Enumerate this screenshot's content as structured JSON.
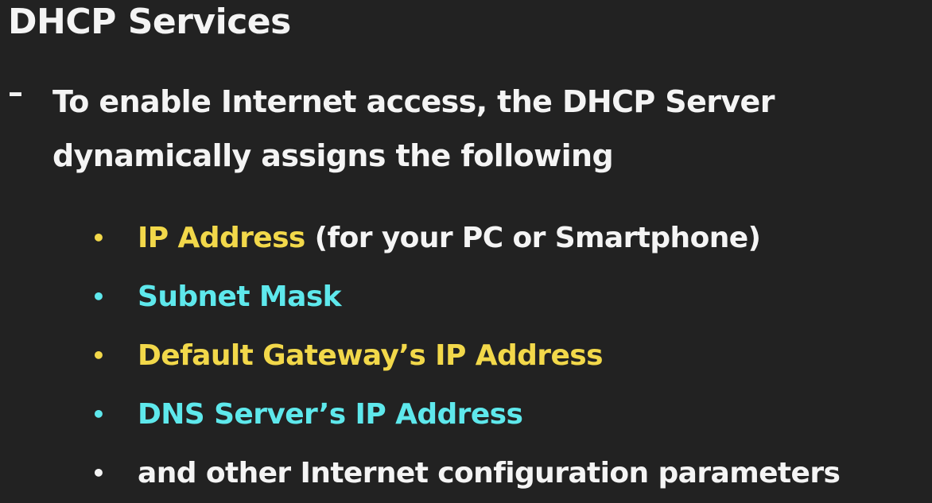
{
  "title": "DHCP Services",
  "intro": {
    "dash": "–",
    "line1": "To enable Internet access, the DHCP Server",
    "line2": "dynamically assigns the following"
  },
  "bullets": [
    {
      "highlight": "IP Address",
      "rest": " (for your PC or Smartphone)",
      "color": "#f2d84a"
    },
    {
      "highlight": "Subnet Mask",
      "rest": "",
      "color": "#5ee8ec"
    },
    {
      "highlight": "Default Gateway’s IP Address",
      "rest": "",
      "color": "#f2d84a"
    },
    {
      "highlight": "DNS Server’s IP Address",
      "rest": "",
      "color": "#5ee8ec"
    },
    {
      "highlight": "and other Internet configuration parameters",
      "rest": "",
      "color": "#f4f4f4"
    }
  ],
  "bullet_glyph": "•"
}
